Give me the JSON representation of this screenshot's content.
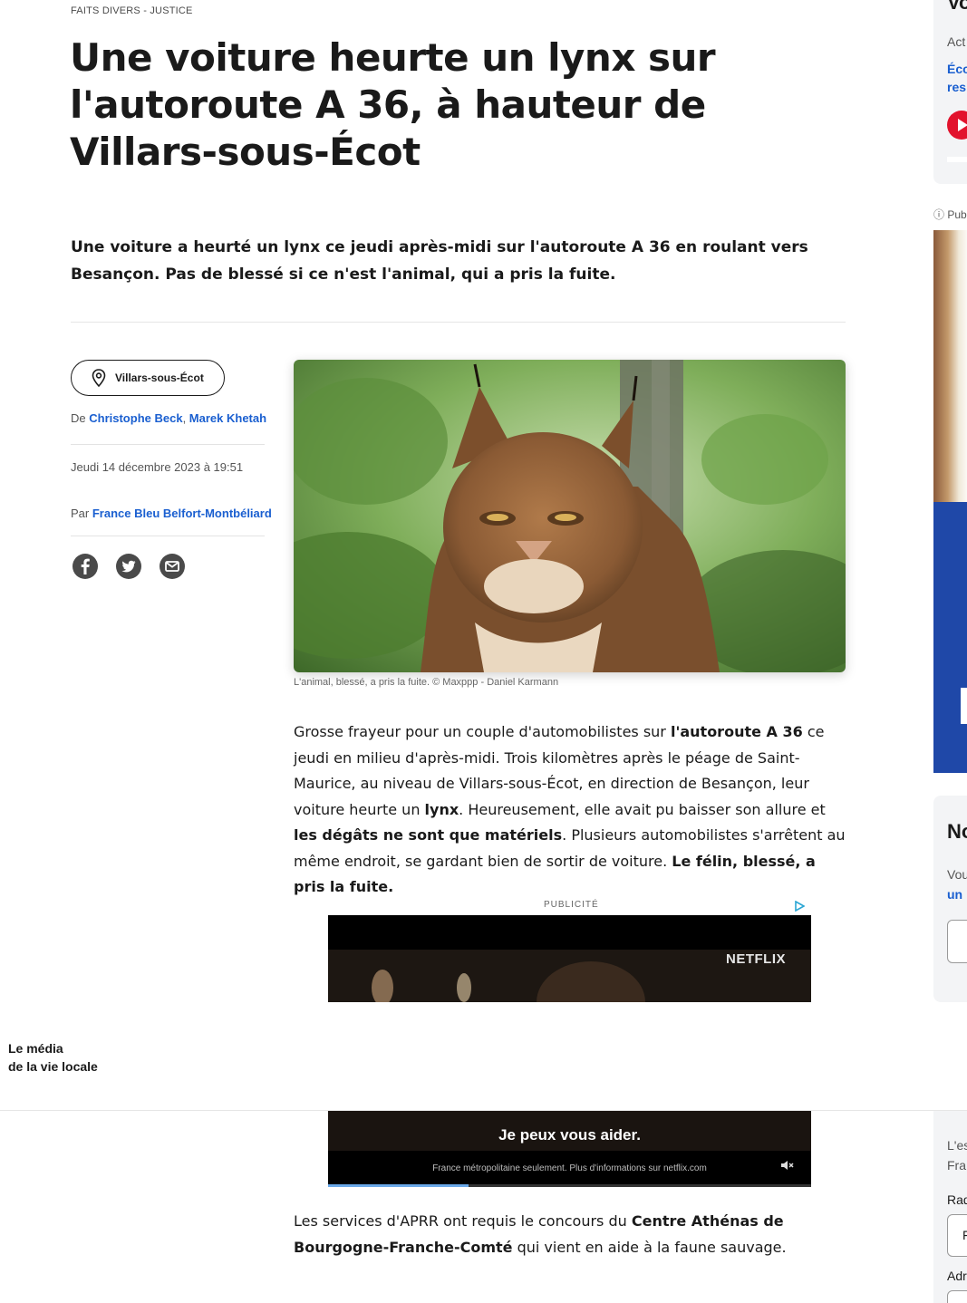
{
  "breadcrumb": "FAITS DIVERS - JUSTICE",
  "title": "Une voiture heurte un lynx sur l'autoroute A 36, à hauteur de Villars-sous-Écot",
  "lede": "Une voiture a heurté un lynx ce jeudi après-midi sur l'autoroute A 36 en roulant vers Besançon. Pas de blessé si ce n'est l'animal, qui a pris la fuite.",
  "meta": {
    "location": "Villars-sous-Écot",
    "by_prefix": "De",
    "authors": [
      "Christophe Beck",
      "Marek Khetah"
    ],
    "author_sep": ", ",
    "date": "Jeudi 14 décembre 2023 à 19:51",
    "par_prefix": "Par",
    "source": "France Bleu Belfort-Montbéliard"
  },
  "share": {
    "icons": [
      "facebook-icon",
      "twitter-icon",
      "email-icon"
    ]
  },
  "photo": {
    "caption": "L'animal, blessé, a pris la fuite. © Maxppp - Daniel Karmann"
  },
  "paragraph1": {
    "t1": "Grosse frayeur pour un couple d'automobilistes sur ",
    "b1": "l'autoroute A 36",
    "t2": " ce jeudi en milieu d'après-midi. Trois kilomètres après le péage de Saint-Maurice, au niveau de Villars-sous-Écot, en direction de Besançon, leur voiture heurte un ",
    "b2": "lynx",
    "t3": ". Heureusement, elle avait pu baisser son allure et ",
    "b3": "les dégâts ne sont que matériels",
    "t4": ". Plusieurs automobilistes s'arrêtent au même endroit, se gardant bien de sortir de voiture. ",
    "b4": "Le félin, blessé, a pris la fuite."
  },
  "ad": {
    "label": "PUBLICITÉ",
    "brand": "NETFLIX",
    "tagline": "Je peux vous aider.",
    "disclaimer": "France métropolitaine seulement. Plus d'informations sur netflix.com",
    "progress": 0.29
  },
  "footer": {
    "tagline_line1": "Le média",
    "tagline_line2": "de la vie locale"
  },
  "paragraph2": {
    "t1": "Les services d'APRR ont requis le concours du ",
    "b1": "Centre Athénas de Bourgogne-Franche-Comté",
    "t2": " qui vient en aide à la faune sauvage."
  },
  "rail": {
    "card1_title": "Vo",
    "card1_sub": "Act",
    "card1_link_l1": "Éco",
    "card1_link_l2": "res",
    "pub_label": "ⓘ Pub",
    "card2_title": "No",
    "card2_text": "Vou",
    "card2_link": "un",
    "card3_text_l1": "L'es",
    "card3_text_l2": "Fra",
    "radio_label": "Rad",
    "radio_value": "F",
    "address_label": "Adr"
  },
  "colors": {
    "link": "#1a5fd0",
    "play": "#e2132d",
    "rail_bg": "#f3f4f6"
  }
}
